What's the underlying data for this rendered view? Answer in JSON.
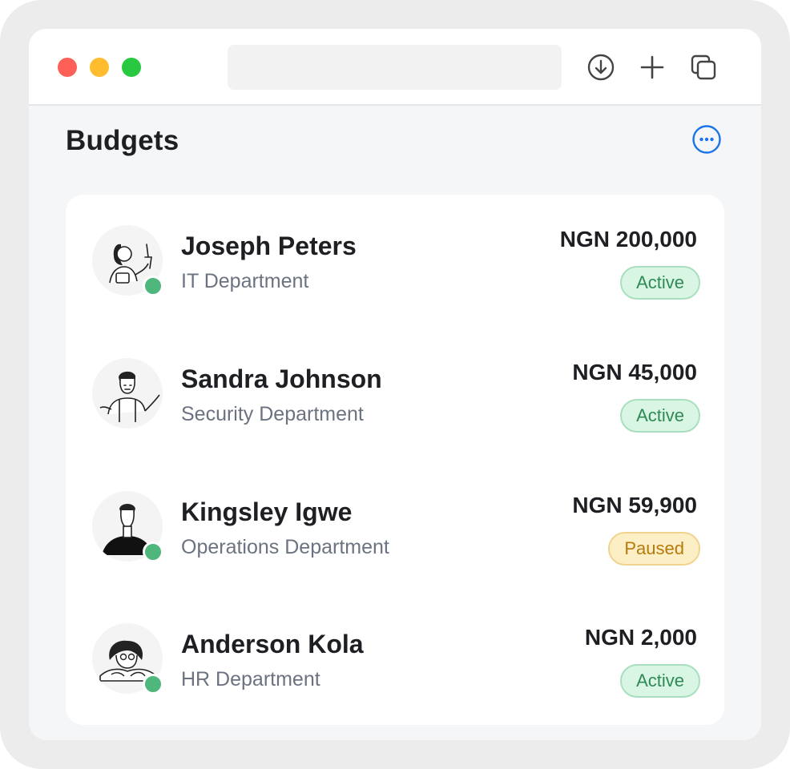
{
  "window": {
    "icons": [
      "download-icon",
      "plus-icon",
      "copy-tabs-icon"
    ]
  },
  "page": {
    "title": "Budgets",
    "more_icon": "ellipsis-circle-icon",
    "accent_color": "#1a73e8"
  },
  "budgets": [
    {
      "name": "Joseph Peters",
      "department": "IT Department",
      "amount": "NGN 200,000",
      "status": "Active",
      "online": true
    },
    {
      "name": "Sandra Johnson",
      "department": "Security Department",
      "amount": "NGN 45,000",
      "status": "Active",
      "online": false
    },
    {
      "name": "Kingsley Igwe",
      "department": "Operations Department",
      "amount": "NGN 59,900",
      "status": "Paused",
      "online": true
    },
    {
      "name": "Anderson Kola",
      "department": "HR Department",
      "amount": "NGN 2,000",
      "status": "Active",
      "online": true
    }
  ],
  "status_colors": {
    "Active": "#2f8a56",
    "Paused": "#b7790b",
    "online": "#4fb77c"
  }
}
